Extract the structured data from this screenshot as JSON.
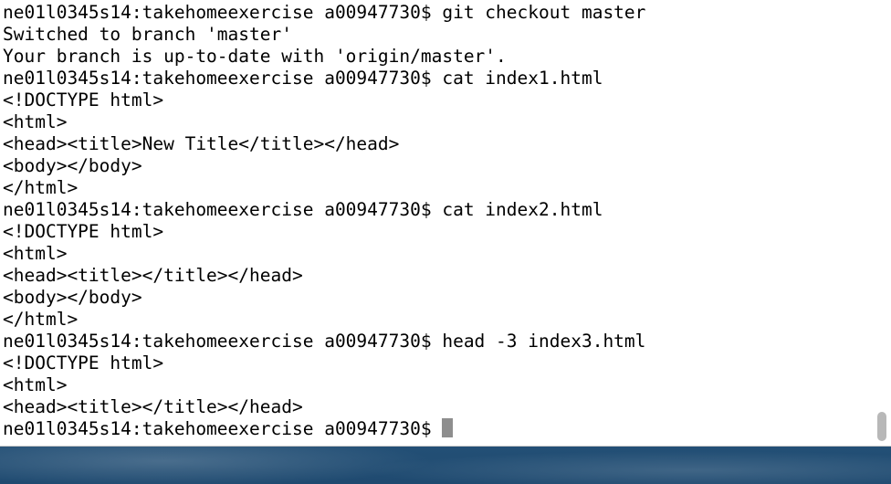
{
  "terminal": {
    "lines": [
      {
        "text": "ne01l0345s14:takehomeexercise a00947730$ git checkout master"
      },
      {
        "text": "Switched to branch 'master'"
      },
      {
        "text": "Your branch is up-to-date with 'origin/master'."
      },
      {
        "text": "ne01l0345s14:takehomeexercise a00947730$ cat index1.html"
      },
      {
        "text": "<!DOCTYPE html>"
      },
      {
        "text": "<html>"
      },
      {
        "text": "<head><title>New Title</title></head>"
      },
      {
        "text": "<body></body>"
      },
      {
        "text": "</html>"
      },
      {
        "text": "ne01l0345s14:takehomeexercise a00947730$ cat index2.html"
      },
      {
        "text": "<!DOCTYPE html>"
      },
      {
        "text": "<html>"
      },
      {
        "text": "<head><title></title></head>"
      },
      {
        "text": "<body></body>"
      },
      {
        "text": "</html>"
      },
      {
        "text": "ne01l0345s14:takehomeexercise a00947730$ head -3 index3.html"
      },
      {
        "text": "<!DOCTYPE html>"
      },
      {
        "text": "<html>"
      },
      {
        "text": "<head><title></title></head>"
      }
    ],
    "prompt": "ne01l0345s14:takehomeexercise a00947730$ "
  },
  "colors": {
    "terminal_background": "#ffffff",
    "text": "#000000",
    "cursor": "#8e8e8e",
    "desktop": "#3f6f96"
  }
}
